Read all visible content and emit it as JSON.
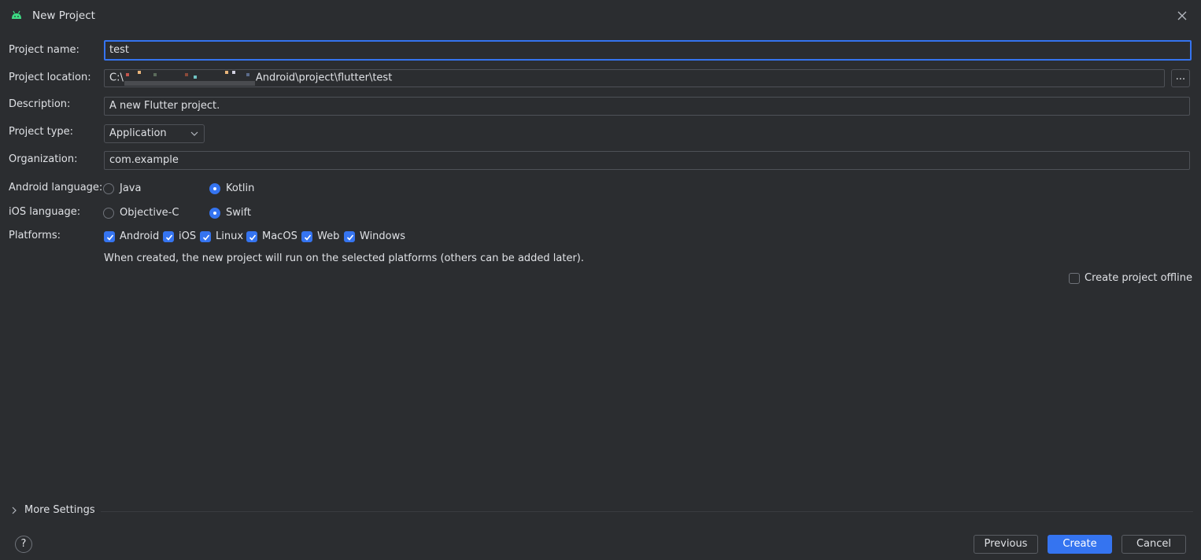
{
  "window": {
    "title": "New Project"
  },
  "form": {
    "project_name_label": "Project name:",
    "project_name_value": "test",
    "project_location_label": "Project location:",
    "project_location_prefix": "C:\\",
    "project_location_suffix": "Android\\project\\flutter\\test",
    "browse_label": "...",
    "description_label": "Description:",
    "description_value": "A new Flutter project.",
    "project_type_label": "Project type:",
    "project_type_value": "Application",
    "organization_label": "Organization:",
    "organization_value": "com.example",
    "android_language_label": "Android language:",
    "android_options": [
      {
        "label": "Java",
        "selected": false
      },
      {
        "label": "Kotlin",
        "selected": true
      }
    ],
    "ios_language_label": "iOS language:",
    "ios_options": [
      {
        "label": "Objective-C",
        "selected": false
      },
      {
        "label": "Swift",
        "selected": true
      }
    ],
    "platforms_label": "Platforms:",
    "platforms": [
      {
        "label": "Android",
        "checked": true
      },
      {
        "label": "iOS",
        "checked": true
      },
      {
        "label": "Linux",
        "checked": true
      },
      {
        "label": "MacOS",
        "checked": true
      },
      {
        "label": "Web",
        "checked": true
      },
      {
        "label": "Windows",
        "checked": true
      }
    ],
    "platforms_hint": "When created, the new project will run on the selected platforms (others can be added later).",
    "offline_label": "Create project offline",
    "offline_checked": false
  },
  "footer": {
    "more_settings": "More Settings",
    "help": "?",
    "previous": "Previous",
    "create": "Create",
    "cancel": "Cancel"
  },
  "colors": {
    "background": "#2b2d30",
    "accent": "#3574f0",
    "android_green": "#3ddc84",
    "text": "#dfe1e5",
    "border": "#4e5157"
  },
  "icons": {
    "title": "android-icon",
    "close": "close-icon",
    "dropdown": "chevron-down-icon",
    "more": "chevron-right-icon",
    "help": "help-icon"
  }
}
